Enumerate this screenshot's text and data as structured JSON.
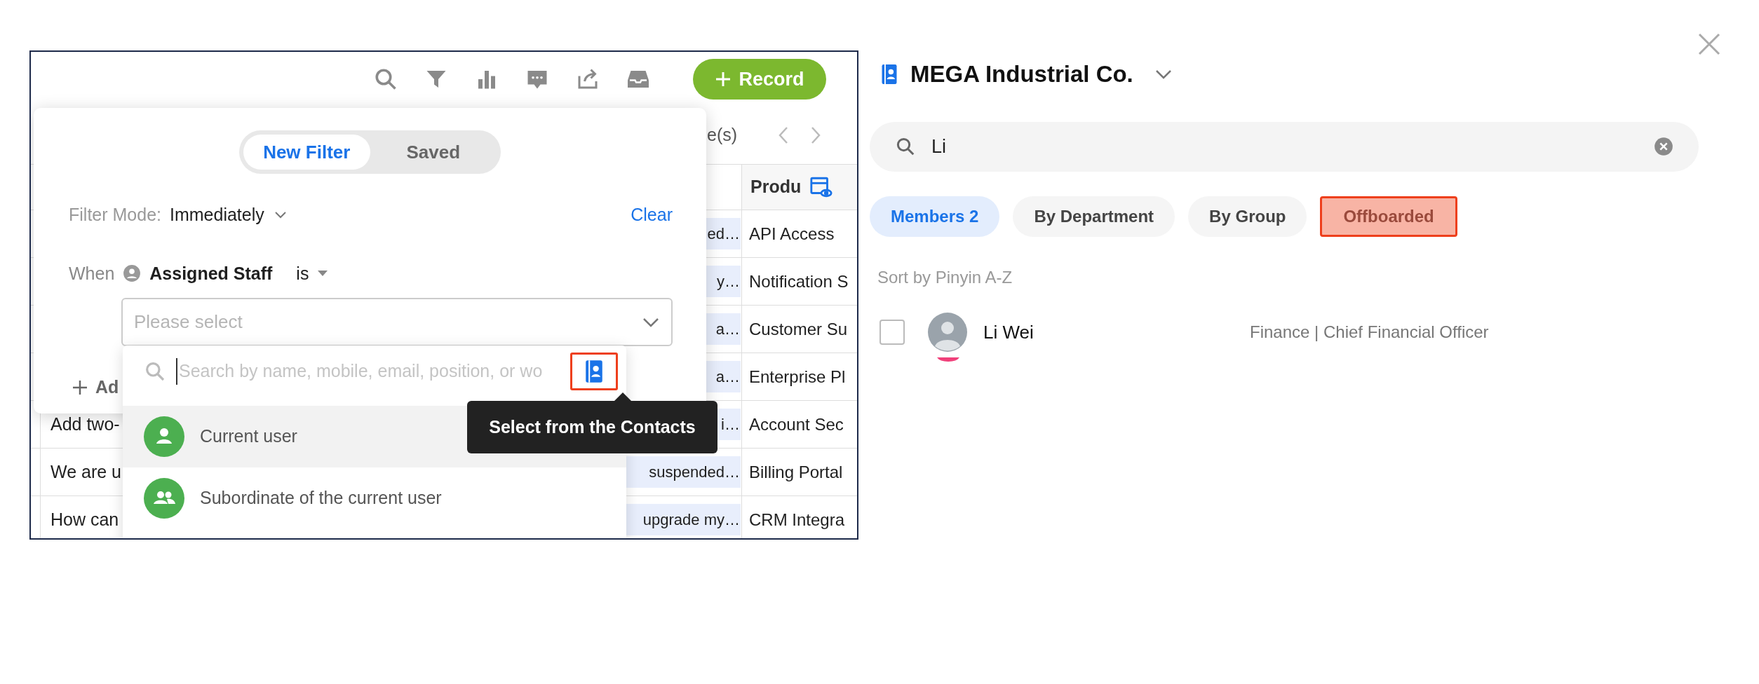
{
  "toolbar": {
    "record_button": "Record"
  },
  "table": {
    "pager": "e(s)",
    "product_column": "Produ",
    "rows": [
      {
        "tag": "ed…",
        "product": "API Access"
      },
      {
        "tag": "y…",
        "product": "Notification S"
      },
      {
        "tag": "a…",
        "product": "Customer Su"
      },
      {
        "tag": "a…",
        "product": "Enterprise Pl"
      },
      {
        "text": "Add two-",
        "tag": "i…",
        "product": "Account Sec"
      },
      {
        "text": "We are u",
        "tag": "suspended…",
        "product": "Billing Portal"
      },
      {
        "text": "How can",
        "tag": "upgrade my…",
        "product": "CRM Integra"
      }
    ]
  },
  "filter_popover": {
    "tabs": [
      {
        "label": "New Filter",
        "selected": true
      },
      {
        "label": "Saved",
        "selected": false
      }
    ],
    "mode_label": "Filter Mode:",
    "mode_value": "Immediately",
    "clear": "Clear",
    "condition": {
      "prefix": "When",
      "field": "Assigned Staff",
      "operator": "is",
      "placeholder": "Please select"
    },
    "add_label": "Ad"
  },
  "staff_dropdown": {
    "search_placeholder": "Search by name, mobile, email, position, or wo",
    "contacts_button_highlighted": true,
    "options": [
      {
        "label": "Current user",
        "kind": "user",
        "highlighted": true
      },
      {
        "label": "Subordinate of the current user",
        "kind": "group",
        "highlighted": false
      }
    ]
  },
  "tooltip": "Select from the Contacts",
  "contacts_panel": {
    "title": "MEGA Industrial Co.",
    "search": {
      "value": "Li"
    },
    "tabs": [
      {
        "label": "Members 2",
        "selected": true,
        "highlighted": false
      },
      {
        "label": "By Department",
        "selected": false,
        "highlighted": false
      },
      {
        "label": "By Group",
        "selected": false,
        "highlighted": false
      },
      {
        "label": "Offboarded",
        "selected": false,
        "highlighted": true
      }
    ],
    "sort_label": "Sort by Pinyin A-Z",
    "members": [
      {
        "name": "Li Wei",
        "detail": "Finance | Chief Financial Officer",
        "checked": false
      }
    ]
  }
}
